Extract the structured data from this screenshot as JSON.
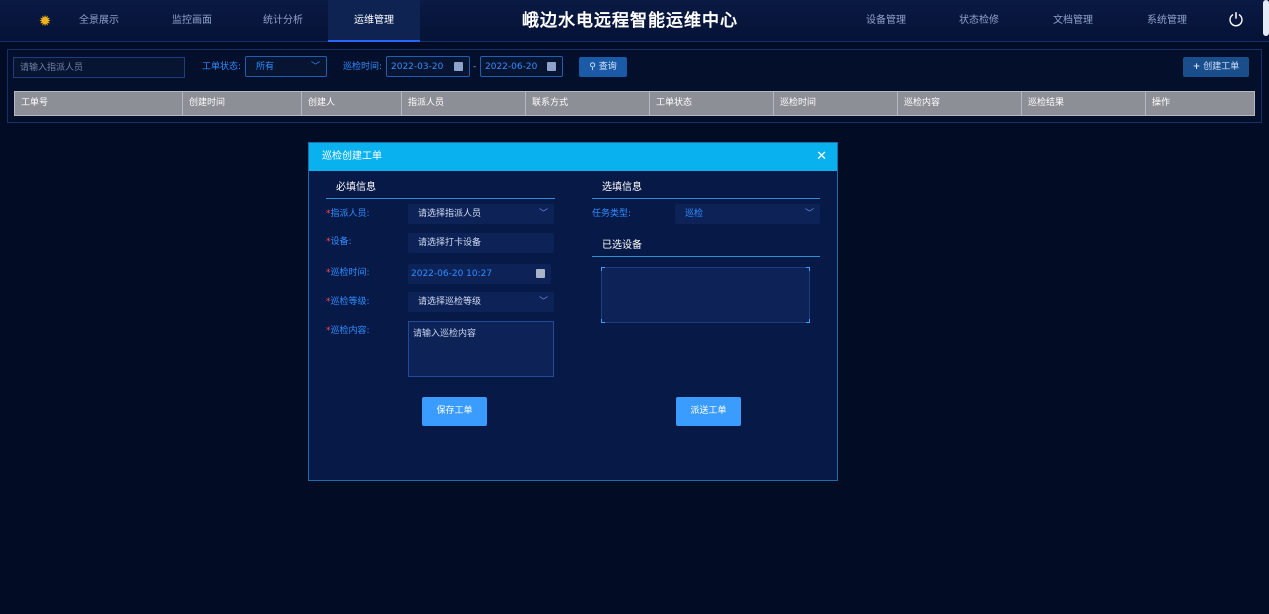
{
  "header": {
    "title": "峨边水电远程智能运维中心",
    "nav_left": [
      "全景展示",
      "监控画面",
      "统计分析",
      "运维管理"
    ],
    "nav_right": [
      "设备管理",
      "状态检修",
      "文档管理",
      "系统管理"
    ],
    "active_nav": "运维管理",
    "logo_icon": "alarm-light-icon",
    "power_icon": "power-icon",
    "accent_color": "#2a64ff"
  },
  "filters": {
    "assignee_placeholder": "请输入指派人员",
    "status_label": "工单状态:",
    "status_value": "所有",
    "time_label": "巡检时间:",
    "date_start": "2022-03-20",
    "date_sep": "-",
    "date_end": "2022-06-20",
    "query_label": "查询",
    "create_label": "创建工单"
  },
  "table": {
    "columns": [
      "工单号",
      "创建时间",
      "创建人",
      "指派人员",
      "联系方式",
      "工单状态",
      "巡检时间",
      "巡检内容",
      "巡检结果",
      "操作"
    ]
  },
  "modal": {
    "title": "巡检创建工单",
    "required_section": "必填信息",
    "optional_section": "选填信息",
    "selected_devices_section": "已选设备",
    "fields": {
      "assignee_label": "指派人员:",
      "assignee_placeholder": "请选择指派人员",
      "device_label": "设备:",
      "device_placeholder": "请选择打卡设备",
      "time_label": "巡检时间:",
      "time_value": "2022-06-20 10:27",
      "level_label": "巡检等级:",
      "level_placeholder": "请选择巡检等级",
      "content_label": "巡检内容:",
      "content_placeholder": "请输入巡检内容",
      "task_type_label": "任务类型:",
      "task_type_value": "巡检"
    },
    "save_label": "保存工单",
    "send_label": "派送工单",
    "header_color": "#0ab1ef",
    "button_color": "#3b9cff"
  }
}
